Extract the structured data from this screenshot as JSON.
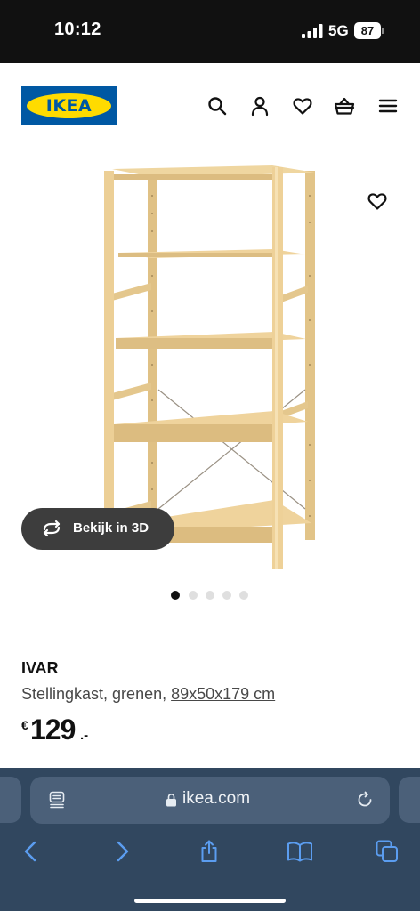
{
  "status_bar": {
    "time": "10:12",
    "network": "5G",
    "battery": "87"
  },
  "header": {
    "logo_text": "IKEA",
    "icons": [
      "search-icon",
      "account-icon",
      "favourites-icon",
      "basket-icon",
      "menu-icon"
    ]
  },
  "gallery": {
    "view_3d_label": "Bekijk in 3D",
    "image_count": 5,
    "active_index": 0
  },
  "product": {
    "name": "IVAR",
    "description": "Stellingkast, grenen, ",
    "size": "89x50x179 cm",
    "price_currency": "€",
    "price_value": "129",
    "price_suffix": ".-"
  },
  "browser": {
    "url": "ikea.com",
    "toolbar_icons": [
      "back-icon",
      "forward-icon",
      "share-icon",
      "bookmarks-icon",
      "tabs-icon"
    ]
  },
  "colors": {
    "ikea_blue": "#0058a3",
    "ikea_yellow": "#ffdb00",
    "wood": "#ecd195",
    "browser_bar": "#31475f"
  }
}
